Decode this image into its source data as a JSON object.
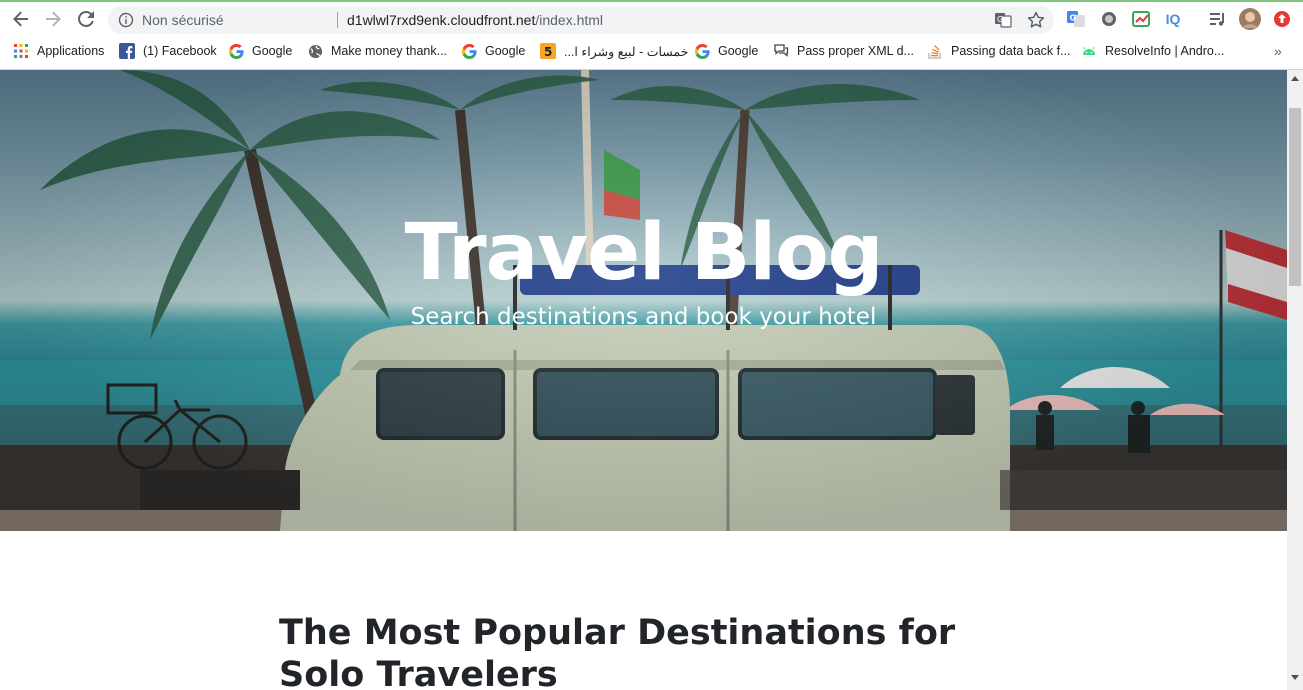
{
  "browser": {
    "security_label": "Non sécurisé",
    "url_host": "d1wlwl7rxd9enk.cloudfront.net",
    "url_path": "/index.html",
    "extensions": [
      {
        "name": "google-translate-extension",
        "color": "#4285f4"
      },
      {
        "name": "circle-extension",
        "color": "#5f6368"
      },
      {
        "name": "chart-extension",
        "color": "#34a853"
      },
      {
        "name": "iq-extension",
        "label": "IQ",
        "color": "#4a90d9"
      },
      {
        "name": "playlist-extension",
        "color": "#5f6368"
      },
      {
        "name": "alert-extension",
        "color": "#e53935"
      }
    ]
  },
  "bookmarks": [
    {
      "label": "Applications",
      "icon": "apps-grid-icon"
    },
    {
      "label": "(1) Facebook",
      "icon": "facebook-icon"
    },
    {
      "label": "Google",
      "icon": "google-icon"
    },
    {
      "label": "Make money thank...",
      "icon": "globe-icon"
    },
    {
      "label": "Google",
      "icon": "google-icon"
    },
    {
      "label": "خمسات - لبيع وشراء ا...",
      "icon": "khamsat-icon"
    },
    {
      "label": "Google",
      "icon": "google-icon"
    },
    {
      "label": "Pass proper XML d...",
      "icon": "chat-icon"
    },
    {
      "label": "Passing data back f...",
      "icon": "stackoverflow-icon"
    },
    {
      "label": "ResolveInfo | Andro...",
      "icon": "android-icon"
    }
  ],
  "hero": {
    "title": "Travel Blog",
    "subtitle": "Search destinations and book your hotel"
  },
  "article": {
    "title": "The Most Popular Destinations for Solo Travelers"
  },
  "colors": {
    "accent_green": "#7fc67f",
    "text_dark": "#212529"
  }
}
